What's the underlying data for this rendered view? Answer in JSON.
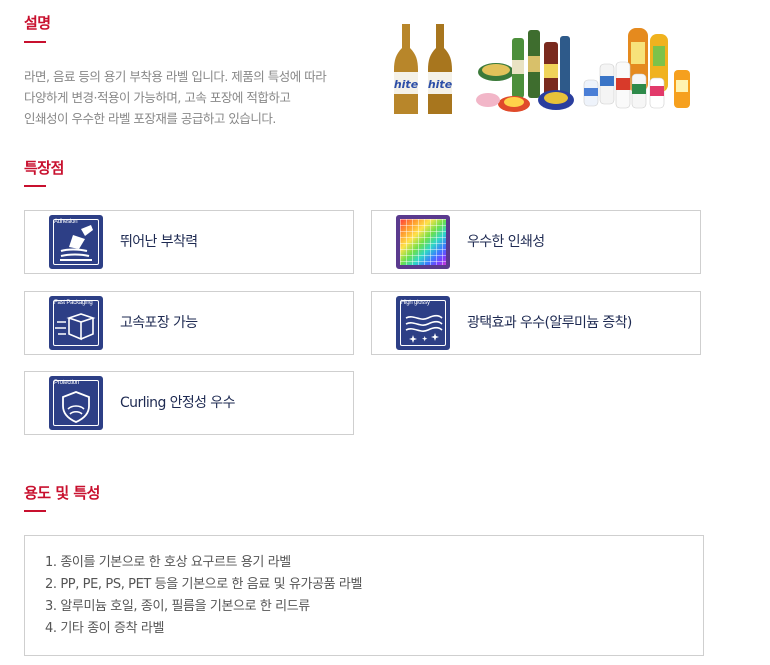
{
  "description": {
    "title": "설명",
    "lines": [
      "라면, 음료 등의 용기 부착용 라벨 입니다. 제품의 특성에 따라",
      "다양하게 변경·적용이 가능하며, 고속 포장에 적합하고",
      "인쇄성이 우수한 라벨 포장재를 공급하고 있습니다."
    ],
    "image_brand_text": "hite"
  },
  "features": {
    "title": "특장점",
    "items": [
      {
        "icon": "adhesion-icon",
        "icon_tag": "Adhesion",
        "label": "뛰어난 부착력"
      },
      {
        "icon": "printability-icon",
        "icon_tag": "",
        "label": "우수한 인쇄성"
      },
      {
        "icon": "fast-packaging-icon",
        "icon_tag": "Fast Packaging",
        "label": "고속포장 가능"
      },
      {
        "icon": "high-glossy-icon",
        "icon_tag": "High glossy",
        "label": "광택효과 우수(알루미늄 증착)"
      },
      {
        "icon": "protection-icon",
        "icon_tag": "Protection",
        "label": "Curling 안정성 우수"
      }
    ]
  },
  "usage": {
    "title": "용도 및 특성",
    "items": [
      "1. 종이를 기본으로 한 호상 요구르트 용기 라벨",
      "2. PP, PE, PS, PET 등을 기본으로 한 음료 및 유가공품 라벨",
      "3. 알루미늄 호일, 종이, 필름을 기본으로 한 리드류",
      "4. 기타 종이 증착 라벨"
    ]
  },
  "colors": {
    "accent": "#c8102e",
    "icon_navy": "#2d3f86",
    "label_text": "#1e2a52",
    "border": "#cfcfcf"
  }
}
